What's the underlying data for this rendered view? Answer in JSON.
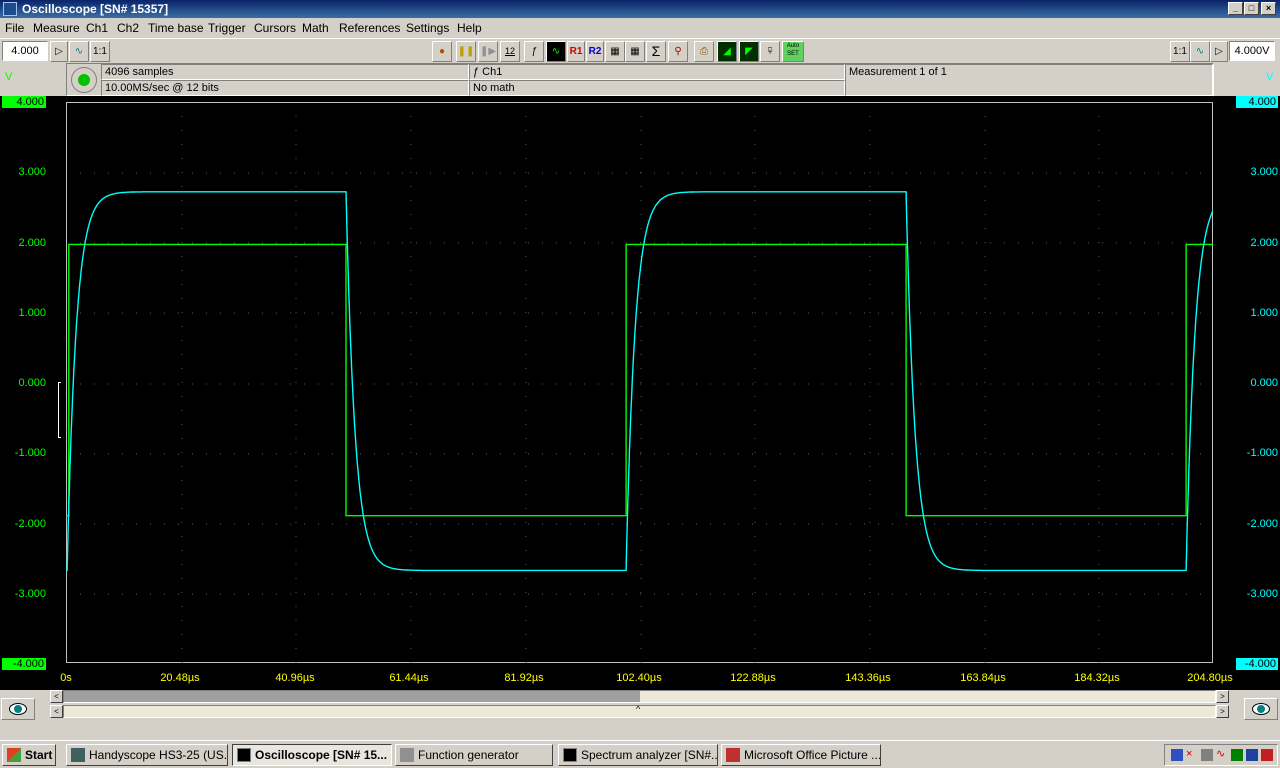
{
  "window": {
    "title": "Oscilloscope  [SN# 15357]",
    "buttons": [
      "_",
      "□",
      "×"
    ]
  },
  "menu": [
    "File",
    "Measure",
    "Ch1",
    "Ch2",
    "Time base",
    "Trigger",
    "Cursors",
    "Math",
    "References",
    "Settings",
    "Help"
  ],
  "toolbar": {
    "ch1_range": "4.000",
    "ch2_range": "4.000V",
    "ratio_left": "1:1",
    "ratio_right": "1:1",
    "samples_label": "12",
    "ref1": "R1",
    "ref2": "R2",
    "autoset": "Auto SET"
  },
  "info": {
    "samples": "4096 samples",
    "rate": "10.00MS/sec @ 12 bits",
    "channel": "ƒ Ch1",
    "math": "No math",
    "measurement": "Measurement 1 of 1"
  },
  "axes": {
    "left_unit": "V",
    "right_unit": "V",
    "y_ticks": [
      "4.000",
      "3.000",
      "2.000",
      "1.000",
      "0.000",
      "-1.000",
      "-2.000",
      "-3.000",
      "-4.000"
    ],
    "x_ticks": [
      "0s",
      "20.48µs",
      "40.96µs",
      "61.44µs",
      "81.92µs",
      "102.40µs",
      "122.88µs",
      "143.36µs",
      "163.84µs",
      "184.32µs",
      "204.80µs"
    ]
  },
  "colors": {
    "ch1": "#00ffff",
    "ch2": "#00ff00",
    "x_labels": "#ffff00",
    "background": "#000000",
    "grid": "#5a5a5a"
  },
  "signals": {
    "green_square": {
      "high": 1.97,
      "low": -1.9,
      "edges_us": [
        0.5,
        50.0,
        100.0,
        150.0,
        200.0
      ]
    },
    "cyan_response": {
      "high": 2.72,
      "low": -2.68,
      "edges_us": [
        0.2,
        50.0,
        100.0,
        150.0,
        200.0
      ]
    }
  },
  "taskbar": {
    "start": "Start",
    "tasks": [
      "Handyscope HS3-25 (US...",
      "Oscilloscope  [SN# 15...",
      "Function generator",
      "Spectrum analyzer  [SN#...",
      "Microsoft Office Picture ..."
    ]
  }
}
